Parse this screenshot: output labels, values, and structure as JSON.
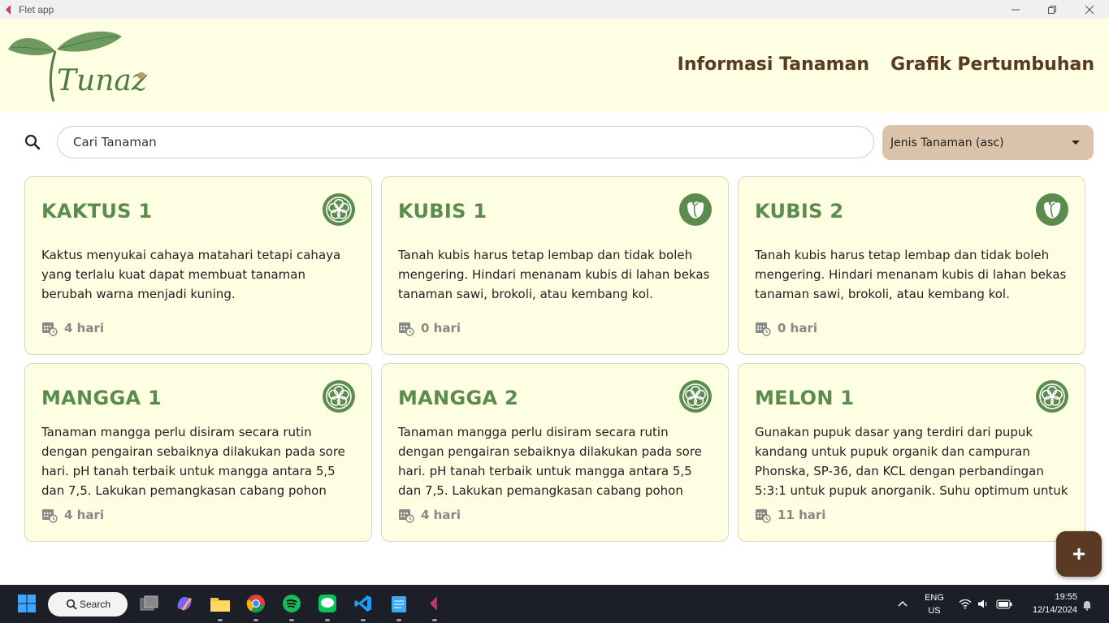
{
  "window": {
    "title": "Flet app"
  },
  "header": {
    "logo_text": "Tunaz",
    "nav": [
      {
        "label": "Informasi Tanaman"
      },
      {
        "label": "Grafik Pertumbuhan"
      }
    ]
  },
  "search": {
    "value": "Cari Tanaman",
    "icon": "search-icon"
  },
  "sort": {
    "selected": "Jenis Tanaman (asc)",
    "icon": "caret-down-icon"
  },
  "cards": [
    {
      "title": "KAKTUS 1",
      "icon": "flower-icon",
      "description": "Kaktus menyukai cahaya matahari tetapi cahaya yang terlalu kuat dapat membuat tanaman berubah warna menjadi kuning.",
      "days": "4 hari"
    },
    {
      "title": "KUBIS 1",
      "icon": "cabbage-icon",
      "description": "Tanah kubis harus tetap lembap dan tidak boleh mengering. Hindari menanam kubis di lahan bekas tanaman sawi, brokoli, atau kembang kol.",
      "days": "0 hari"
    },
    {
      "title": "KUBIS 2",
      "icon": "cabbage-icon",
      "description": "Tanah kubis harus tetap lembap dan tidak boleh mengering. Hindari menanam kubis di lahan bekas tanaman sawi, brokoli, atau kembang kol.",
      "days": "0 hari"
    },
    {
      "title": "MANGGA 1",
      "icon": "flower-icon",
      "description": "Tanaman mangga perlu disiram secara rutin dengan pengairan sebaiknya dilakukan pada sore hari. pH tanah terbaik untuk mangga antara 5,5 dan 7,5. Lakukan pemangkasan cabang pohon secara rutin.",
      "days": "4 hari"
    },
    {
      "title": "MANGGA 2",
      "icon": "flower-icon",
      "description": "Tanaman mangga perlu disiram secara rutin dengan pengairan sebaiknya dilakukan pada sore hari. pH tanah terbaik untuk mangga antara 5,5 dan 7,5. Lakukan pemangkasan cabang pohon secara rutin.",
      "days": "4 hari"
    },
    {
      "title": "MELON 1",
      "icon": "flower-icon",
      "description": "Gunakan pupuk dasar yang terdiri dari pupuk kandang untuk pupuk organik dan campuran Phonska, SP-36, dan KCL dengan perbandingan 5:3:1 untuk pupuk anorganik. Suhu optimum untuk melo...",
      "days": "11 hari"
    }
  ],
  "fab": {
    "icon": "plus-icon"
  },
  "taskbar": {
    "search_label": "Search",
    "language": "ENG",
    "region": "US",
    "time": "19:55",
    "date": "12/14/2024"
  }
}
